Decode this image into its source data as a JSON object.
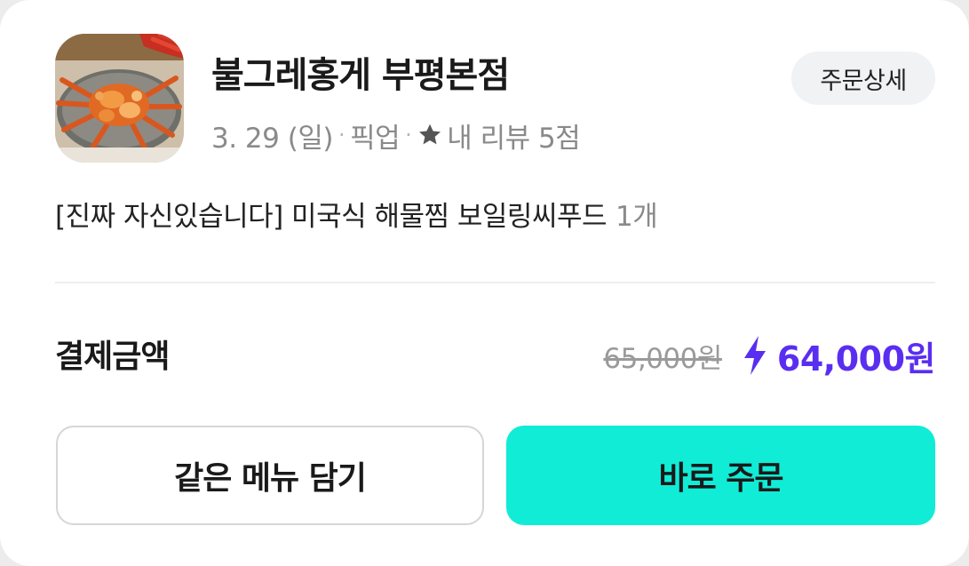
{
  "order": {
    "store_name": "불그레홍게 부평본점",
    "detail_button": "주문상세",
    "date": "3. 29 (일)",
    "separator": "·",
    "order_type": "픽업",
    "review_text": "내 리뷰 5점",
    "menu_text": "[진짜 자신있습니다] 미국식 해물찜 보일링씨푸드",
    "menu_quantity": "1개"
  },
  "payment": {
    "label": "결제금액",
    "original_price": "65,000원",
    "final_price": "64,000원"
  },
  "actions": {
    "reorder_same_label": "같은 메뉴 담기",
    "order_now_label": "바로 주문"
  },
  "icons": {
    "thumbnail": "store-food-image",
    "star": "star-icon",
    "bolt": "lightning-bolt-icon"
  },
  "colors": {
    "accent_price": "#5a2ef0",
    "primary_button": "#11ecd6",
    "secondary_text": "#8a8a8a"
  }
}
